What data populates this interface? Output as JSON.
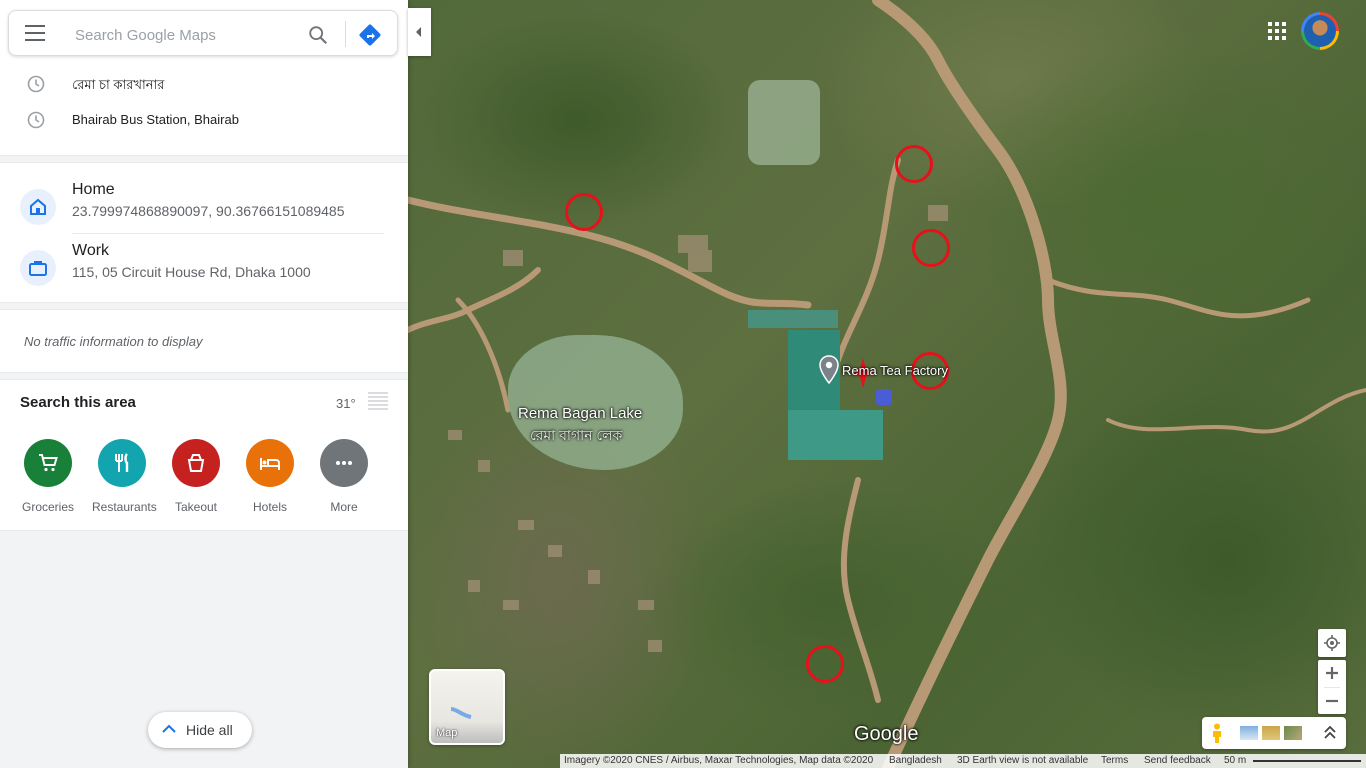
{
  "search": {
    "placeholder": "Search Google Maps"
  },
  "recent": [
    "রেমা চা কারখানার",
    "Bhairab Bus Station, Bhairab"
  ],
  "saved_places": [
    {
      "title": "Home",
      "address": "23.799974868890097, 90.36766151089485",
      "icon": "home-icon"
    },
    {
      "title": "Work",
      "address": "115, 05 Circuit House Rd, Dhaka 1000",
      "icon": "briefcase-icon"
    }
  ],
  "traffic": "No traffic information to display",
  "area": {
    "title": "Search this area",
    "temperature": "31°"
  },
  "categories": [
    {
      "label": "Groceries",
      "color": "#188038",
      "icon": "cart-icon"
    },
    {
      "label": "Restaurants",
      "color": "#12a4af",
      "icon": "fork-knife-icon"
    },
    {
      "label": "Takeout",
      "color": "#c5221f",
      "icon": "takeout-icon"
    },
    {
      "label": "Hotels",
      "color": "#e8710a",
      "icon": "bed-icon"
    },
    {
      "label": "More",
      "color": "#70757a",
      "icon": "more-dots-icon"
    }
  ],
  "hide_all": "Hide all",
  "map": {
    "labels": {
      "factory": "Rema Tea Factory",
      "lake_en": "Rema Bagan Lake",
      "lake_bn": "রেমা বাগান লেক"
    },
    "logo": "Google",
    "layer_toggle": "Map",
    "credits": {
      "imagery": "Imagery ©2020 CNES / Airbus, Maxar Technologies, Map data ©2020",
      "country": "Bangladesh",
      "earth": "3D Earth view is not available",
      "terms": "Terms",
      "feedback": "Send feedback",
      "scale": "50 m"
    }
  }
}
